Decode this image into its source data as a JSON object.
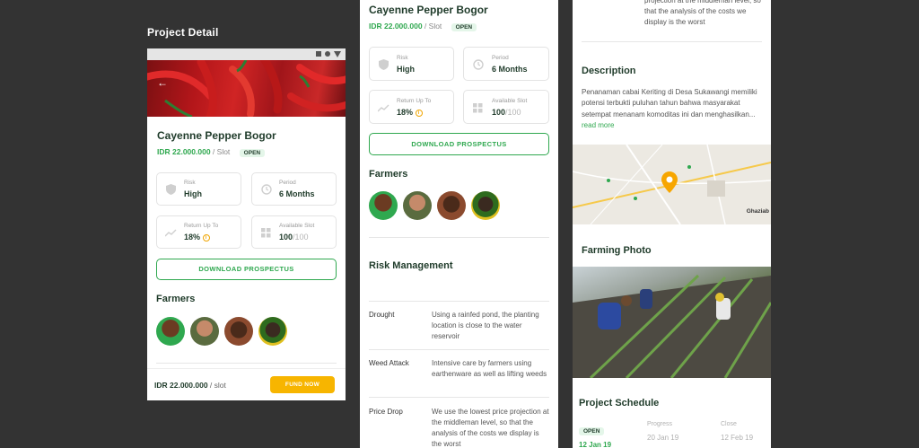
{
  "sheet_title": "Project Detail",
  "project": {
    "name": "Cayenne Pepper Bogor",
    "price": "IDR 22.000.000",
    "per_slot": "/ Slot",
    "status": "OPEN"
  },
  "stats": {
    "risk_label": "Risk",
    "risk_value": "High",
    "period_label": "Period",
    "period_value": "6 Months",
    "return_label": "Return Up To",
    "return_value": "18%",
    "slot_label": "Available Slot",
    "slot_value": "100",
    "slot_total": "/100"
  },
  "download_label": "DOWNLOAD PROSPECTUS",
  "farmers_title": "Farmers",
  "bottom": {
    "price": "IDR 22.000.000",
    "per": " / slot",
    "fund_label": "FUND NOW"
  },
  "risk_management": {
    "title": "Risk Management",
    "rows": [
      {
        "key": "Drought",
        "value": "Using a rainfed pond, the planting location is close to the water reservoir"
      },
      {
        "key": "Weed Attack",
        "value": "Intensive care by farmers using earthenware as well as lifting weeds"
      },
      {
        "key": "Price Drop",
        "value": "We use the lowest price projection at the middleman level, so that the analysis of the costs we display is the worst"
      }
    ],
    "top_continuation": "projection at the middleman level, so that the analysis of the costs we display is the worst"
  },
  "description": {
    "title": "Description",
    "text": "Penanaman cabai Keriting di Desa Sukawangi memiliki potensi  terbukti puluhan tahun bahwa masyarakat setempat menanam komoditas ini dan menghasilkan...",
    "read_more": "read more"
  },
  "map_label": "Ghaziab",
  "farming_photo_title": "Farming Photo",
  "schedule": {
    "title": "Project Schedule",
    "steps": [
      {
        "label": "OPEN",
        "date": "12 Jan 19"
      },
      {
        "label": "Progress",
        "date": "20 Jan 19"
      },
      {
        "label": "Close",
        "date": "12 Feb 19"
      }
    ]
  },
  "colors": {
    "accent": "#2fa84f",
    "cta": "#f7b500",
    "text": "#1f3b2a",
    "background": "#333333"
  }
}
